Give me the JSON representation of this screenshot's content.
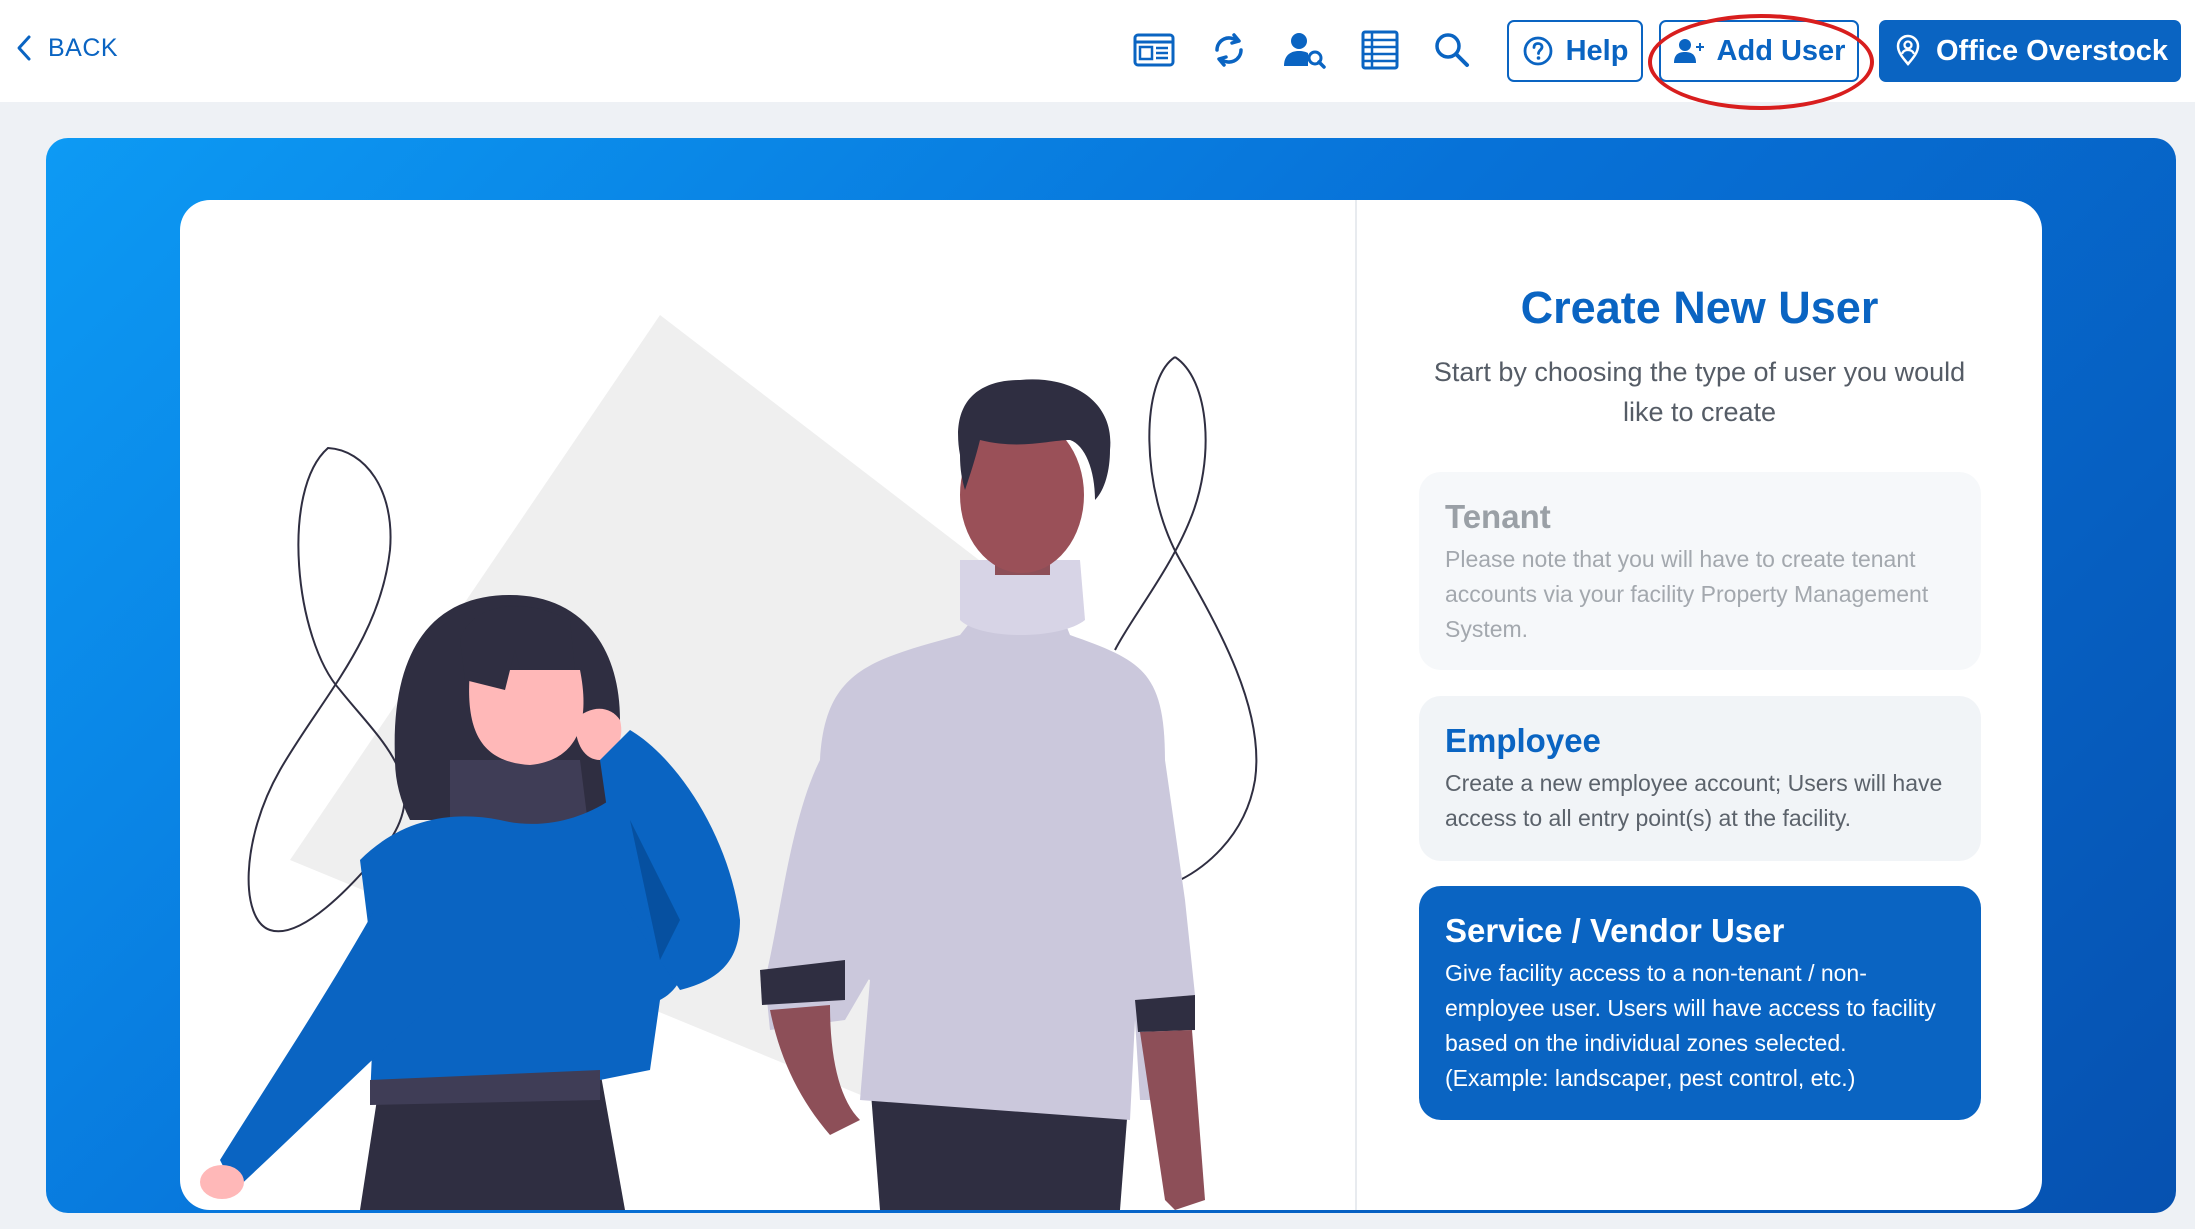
{
  "topbar": {
    "back_label": "BACK",
    "help_label": "Help",
    "add_user_label": "Add User",
    "facility_label": "Office Overstock",
    "tools": [
      "dashboard-icon",
      "refresh-icon",
      "user-search-icon",
      "list-icon",
      "search-icon"
    ]
  },
  "panel": {
    "title": "Create New User",
    "subtitle": "Start by choosing the type of user you would like to create",
    "options": [
      {
        "title": "Tenant",
        "description": "Please note that you will have to create tenant accounts via your facility Property Management System."
      },
      {
        "title": "Employee",
        "description": "Create a new employee account; Users will have access to all entry point(s) at the facility."
      },
      {
        "title": "Service / Vendor User",
        "description": "Give facility access to a non-tenant / non-employee user. Users will have access to facility based on the individual zones selected. (Example: landscaper, pest control, etc.)"
      }
    ]
  },
  "colors": {
    "primary": "#0a64c2",
    "highlight_ring": "#d81e1e",
    "hero_gradient_start": "#0d9af4",
    "hero_gradient_end": "#0651b0"
  }
}
